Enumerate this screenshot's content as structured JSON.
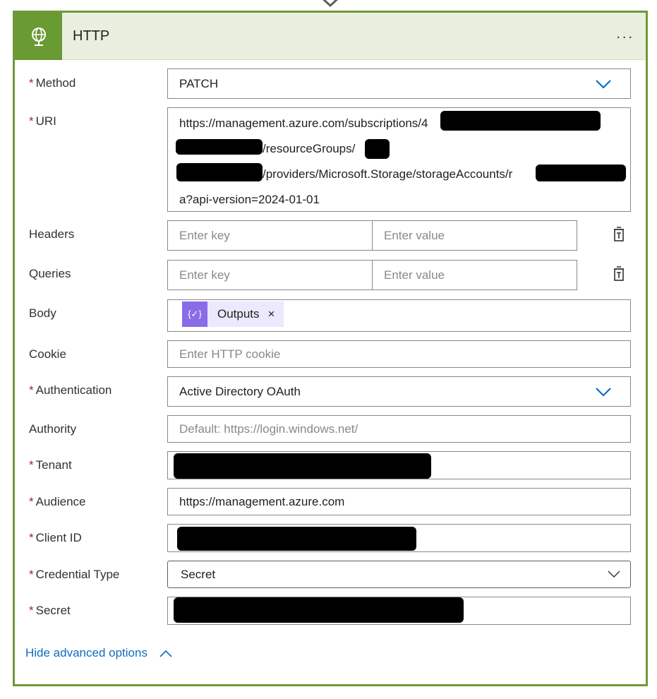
{
  "card": {
    "title": "HTTP",
    "more_label": "..."
  },
  "fields": {
    "method": {
      "label": "Method",
      "value": "PATCH",
      "required_mark": "*"
    },
    "uri": {
      "label": "URI",
      "required_mark": "*",
      "lines": [
        "https://management.azure.com/subscriptions/4",
        "/resourceGroups/",
        "/providers/Microsoft.Storage/storageAccounts/r",
        "a?api-version=2024-01-01"
      ]
    },
    "headers": {
      "label": "Headers",
      "key_placeholder": "Enter key",
      "value_placeholder": "Enter value"
    },
    "queries": {
      "label": "Queries",
      "key_placeholder": "Enter key",
      "value_placeholder": "Enter value"
    },
    "body": {
      "label": "Body",
      "token": "Outputs",
      "token_remove": "×"
    },
    "cookie": {
      "label": "Cookie",
      "placeholder": "Enter HTTP cookie"
    },
    "authentication": {
      "label": "Authentication",
      "value": "Active Directory OAuth",
      "required_mark": "*"
    },
    "authority": {
      "label": "Authority",
      "placeholder": "Default: https://login.windows.net/"
    },
    "tenant": {
      "label": "Tenant",
      "required_mark": "*"
    },
    "audience": {
      "label": "Audience",
      "value": "https://management.azure.com",
      "required_mark": "*"
    },
    "client_id": {
      "label": "Client ID",
      "required_mark": "*"
    },
    "credential_type": {
      "label": "Credential Type",
      "value": "Secret",
      "required_mark": "*"
    },
    "secret": {
      "label": "Secret",
      "required_mark": "*"
    }
  },
  "footer": {
    "hide_advanced": "Hide advanced options"
  },
  "colors": {
    "accent_green": "#6a9a33",
    "header_bg": "#e9efdf",
    "link": "#0f6cbd",
    "required": "#a4262c",
    "token_purple": "#8a6be8"
  },
  "icons": {
    "action": "globe-icon",
    "more": "more-icon",
    "dropdown": "chevron-down-icon",
    "delete": "delete-icon",
    "collapse": "chevron-up-icon",
    "token": "expression-icon"
  }
}
